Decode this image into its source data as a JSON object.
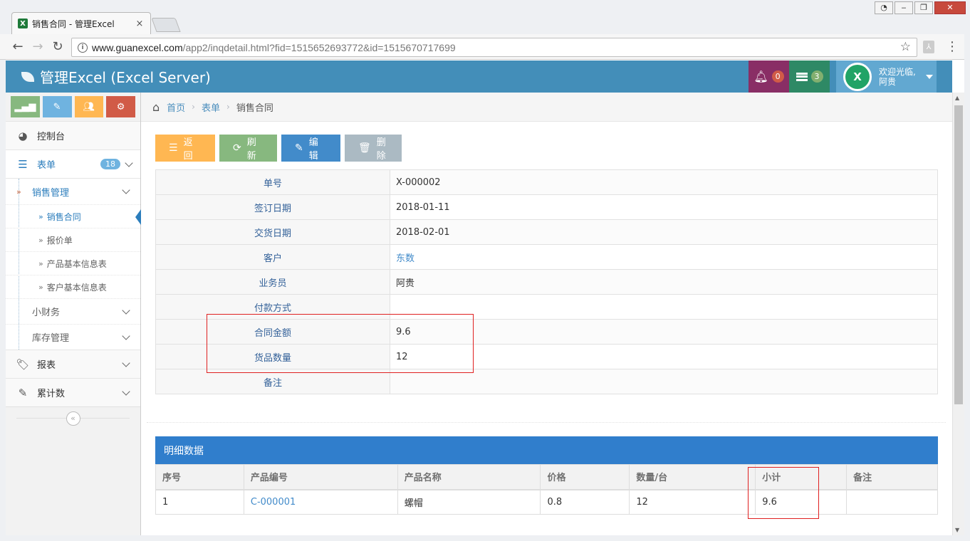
{
  "browser": {
    "tab_title": "销售合同 - 管理Excel",
    "url_main": "www.guanexcel.com",
    "url_rest": "/app2/inqdetail.html?fid=1515652693772&id=1515670717699"
  },
  "header": {
    "brand": "管理Excel (Excel Server)",
    "notifications_count": "0",
    "tasks_count": "3",
    "welcome": "欢迎光临,",
    "username": "阿贵",
    "accent": "#438eb9"
  },
  "sidebar": {
    "items": [
      {
        "label": "控制台"
      },
      {
        "label": "表单",
        "badge": "18"
      },
      {
        "label": "报表"
      },
      {
        "label": "累计数"
      }
    ],
    "form_groups": [
      {
        "label": "销售管理"
      },
      {
        "label": "小财务"
      },
      {
        "label": "库存管理"
      }
    ],
    "sales_items": [
      {
        "label": "销售合同"
      },
      {
        "label": "报价单"
      },
      {
        "label": "产品基本信息表"
      },
      {
        "label": "客户基本信息表"
      }
    ]
  },
  "breadcrumb": {
    "home": "首页",
    "section": "表单",
    "current": "销售合同"
  },
  "toolbar": {
    "back": "返回",
    "refresh": "刷新",
    "edit": "编辑",
    "delete": "删除"
  },
  "record": {
    "rows": [
      {
        "label": "单号",
        "value": "X-000002"
      },
      {
        "label": "签订日期",
        "value": "2018-01-11"
      },
      {
        "label": "交货日期",
        "value": "2018-02-01"
      },
      {
        "label": "客户",
        "value": "东数"
      },
      {
        "label": "业务员",
        "value": "阿贵"
      },
      {
        "label": "付款方式",
        "value": ""
      },
      {
        "label": "合同金额",
        "value": "9.6"
      },
      {
        "label": "货品数量",
        "value": "12"
      },
      {
        "label": "备注",
        "value": ""
      }
    ]
  },
  "detail": {
    "title": "明细数据",
    "columns": [
      "序号",
      "产品编号",
      "产品名称",
      "价格",
      "数量/台",
      "小计",
      "备注"
    ],
    "rows": [
      [
        "1",
        "C-000001",
        "螺帽",
        "0.8",
        "12",
        "9.6",
        ""
      ]
    ]
  }
}
